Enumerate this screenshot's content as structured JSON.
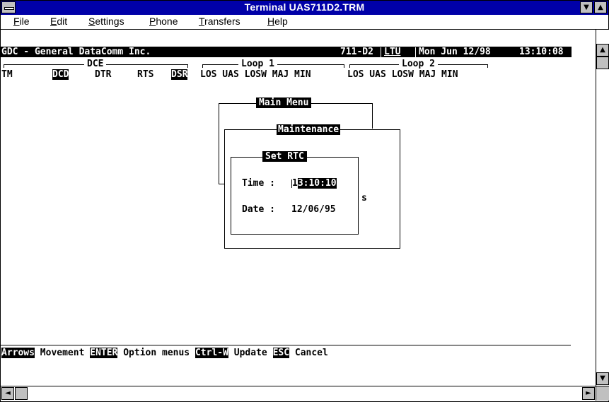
{
  "window": {
    "title": "Terminal  UAS711D2.TRM",
    "minimize_glyph": "▼",
    "maximize_glyph": "▲"
  },
  "menubar": {
    "items": [
      {
        "first": "F",
        "rest": "ile"
      },
      {
        "first": "E",
        "rest": "dit"
      },
      {
        "first": "S",
        "rest": "ettings"
      },
      {
        "first": "P",
        "rest": "hone"
      },
      {
        "first": "T",
        "rest": "ransfers"
      },
      {
        "first": "H",
        "rest": "elp"
      }
    ]
  },
  "header": {
    "company": "GDC - General DataComm Inc.",
    "model": "711-D2",
    "mode": "LTU",
    "date": "Mon Jun 12/98",
    "time": "13:10:08"
  },
  "status": {
    "dce_label": "DCE",
    "loop1_label": "Loop 1",
    "loop2_label": "Loop 2",
    "tm": "TM",
    "dcd": "DCD",
    "dtr": "DTR",
    "rts": "RTS",
    "dsr": "DSR",
    "loop1_fields": "LOS UAS LOSW MAJ MIN",
    "loop2_fields": "LOS UAS LOSW MAJ MIN"
  },
  "dialogs": {
    "main_menu": "Main Menu",
    "maintenance": "Maintenance",
    "set_rtc": "Set RTC",
    "time_label": "Time : ",
    "time_first": "1",
    "time_selected": "3:10:10",
    "time_suffix": "s",
    "date_label": "Date : ",
    "date_value": "12/06/95"
  },
  "footer": {
    "k1": "Arrows",
    "t1": " Movement ",
    "k2": "ENTER",
    "t2": " Option menus ",
    "k3": "Ctrl-W",
    "t3": " Update ",
    "k4": "ESC",
    "t4": " Cancel"
  },
  "scroll": {
    "up": "▲",
    "down": "▼",
    "left": "◄",
    "right": "►"
  }
}
